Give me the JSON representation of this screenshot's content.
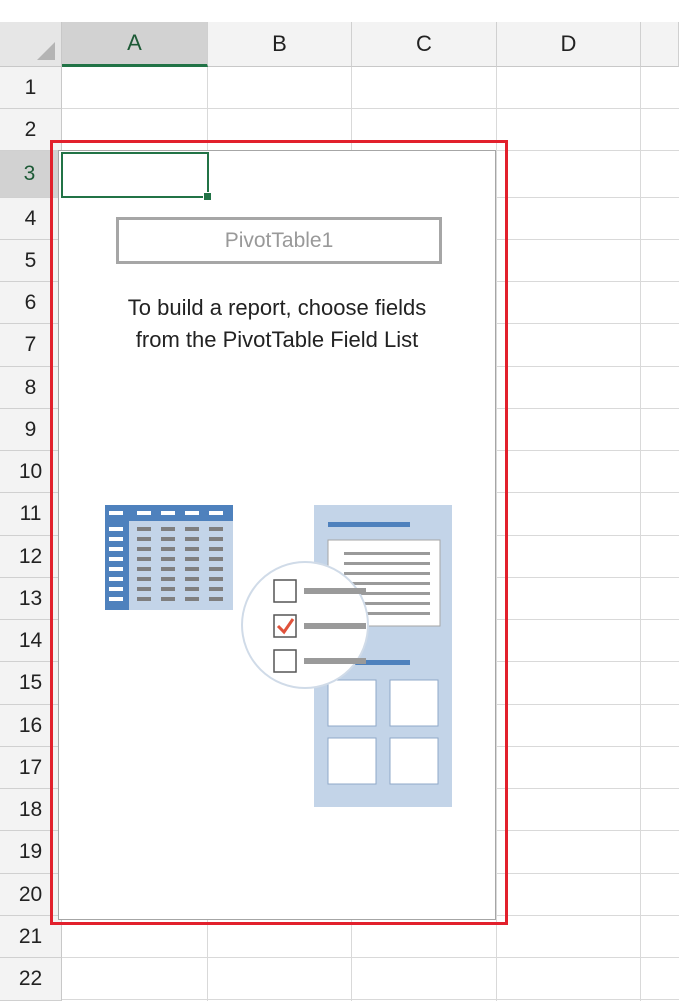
{
  "columns": [
    "A",
    "B",
    "C",
    "D"
  ],
  "active_column": "A",
  "rows": [
    "1",
    "2",
    "3",
    "4",
    "5",
    "6",
    "7",
    "8",
    "9",
    "10",
    "11",
    "12",
    "13",
    "14",
    "15",
    "16",
    "17",
    "18",
    "19",
    "20",
    "21",
    "22"
  ],
  "active_row": "3",
  "pivot": {
    "name": "PivotTable1",
    "instruction_line1": "To build a report, choose fields",
    "instruction_line2": "from the PivotTable Field List"
  },
  "colors": {
    "selection": "#217346",
    "highlight": "#e2202c",
    "illustration_blue": "#4e81bd",
    "illustration_light": "#c3d4e8",
    "check": "#e0523b"
  }
}
